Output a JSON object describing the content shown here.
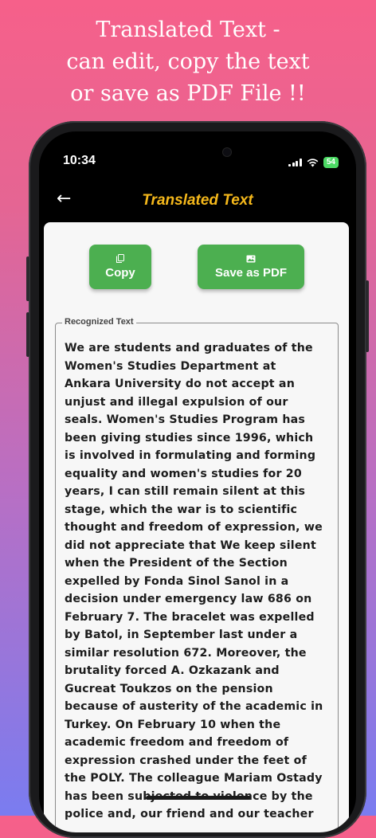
{
  "promo": {
    "lines": [
      "Translated Text -",
      "can edit, copy the text",
      "or save as PDF File !!"
    ]
  },
  "status_bar": {
    "time": "10:34",
    "battery": "54"
  },
  "app_bar": {
    "title": "Translated Text",
    "back_icon": "arrow-left-icon"
  },
  "actions": {
    "copy_label": "Copy",
    "copy_icon": "copy-icon",
    "pdf_label": "Save as PDF",
    "pdf_icon": "image-icon"
  },
  "recognized": {
    "legend": "Recognized Text",
    "lines": [
      "We are students and graduates of the",
      "Women's Studies Department at",
      "Ankara University do not accept an",
      "unjust and illegal expulsion of our",
      "seals. Women's Studies Program has",
      "been giving studies since 1996, which",
      "is involved in formulating and forming",
      "equality and women's studies for 20",
      "years, I can still remain silent at this",
      "stage, which the war is to scientific",
      "thought and freedom of expression, we",
      "did not appreciate that We keep silent",
      "when the President of the Section",
      "expelled by Fonda Sinol Sanol in a",
      "decision under emergency law 686 on",
      "February 7. The bracelet was expelled",
      "by Batol, in September last under a",
      "similar resolution 672. Moreover, the",
      "brutality forced A. Ozkazank and",
      "Gucreat Toukzos on the pension",
      "because of austerity of the academic in",
      "Turkey. On February 10 when the",
      "academic freedom and freedom of",
      "expression crashed under the feet of",
      "the POLY. The colleague Mariam Ostady",
      "has been subjected to violence by the",
      "police and, our friend and our teacher"
    ]
  },
  "colors": {
    "accent_button": "#4caf50",
    "title": "#f5b81b",
    "gradient_top": "#f6608a",
    "gradient_bottom": "#7a7cf0"
  }
}
